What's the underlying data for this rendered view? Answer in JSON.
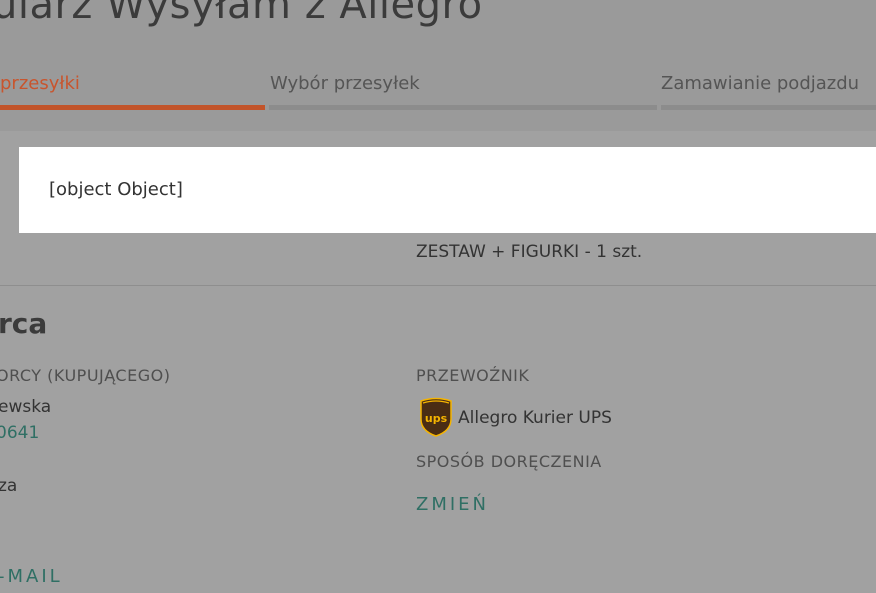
{
  "header": {
    "title": "ularz Wysyłam z Allegro"
  },
  "tabs": [
    {
      "label": "przesyłki",
      "state": "active"
    },
    {
      "label": "Wybór przesyłek",
      "state": "inactive"
    },
    {
      "label": "Zamawianie podjazdu",
      "state": "inactive"
    }
  ],
  "alert": {
    "text": "[object Object]"
  },
  "order": {
    "product": "ZESTAW + FIGURKI - 1 szt."
  },
  "recipient": {
    "section_title": "rca",
    "label": "ORCY (KUPUJĄCEGO)",
    "name_partial": "ewska",
    "phone_partial": "0641",
    "address_partial": "za",
    "email_link": "-MAIL"
  },
  "carrier": {
    "label": "PRZEWOŹNIK",
    "logo_icon": "ups-logo-icon",
    "name": "Allegro Kurier UPS",
    "delivery_label": "SPOSÓB DORĘCZENIA",
    "change_link": "ZMIEŃ"
  },
  "colors": {
    "overlay_bg": "#9a9a9a",
    "active_tab": "#c2542a",
    "link": "#2f6f64",
    "alert_bg": "#ffffff",
    "ups_brown": "#4a2d14",
    "ups_gold": "#f5b400"
  }
}
